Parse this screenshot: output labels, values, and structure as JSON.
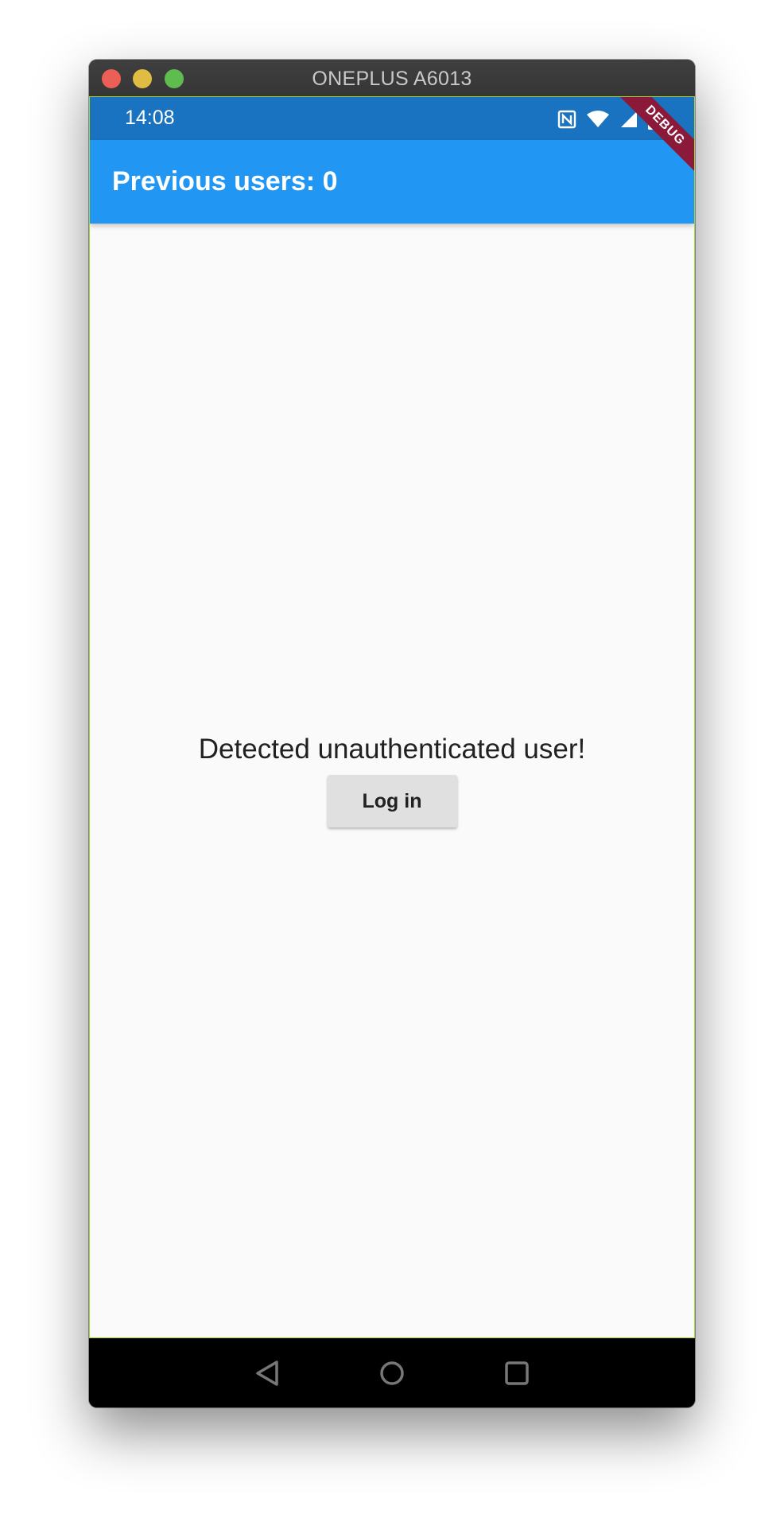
{
  "window": {
    "title": "ONEPLUS A6013"
  },
  "status_bar": {
    "time": "14:08",
    "icons": [
      "nfc-icon",
      "wifi-icon",
      "cell-signal-icon",
      "battery-icon"
    ]
  },
  "app_bar": {
    "title": "Previous users: 0"
  },
  "debug_banner": {
    "label": "DEBUG"
  },
  "body": {
    "message": "Detected unauthenticated user!",
    "login_button_label": "Log in"
  },
  "nav_bar": {
    "buttons": [
      "back-button",
      "home-button",
      "recents-button"
    ]
  },
  "colors": {
    "status_bar": "#1a73c0",
    "app_bar": "#2196f3",
    "background": "#fafafa",
    "button": "#e0e0e0",
    "debug_ribbon": "#8b1a3a"
  }
}
